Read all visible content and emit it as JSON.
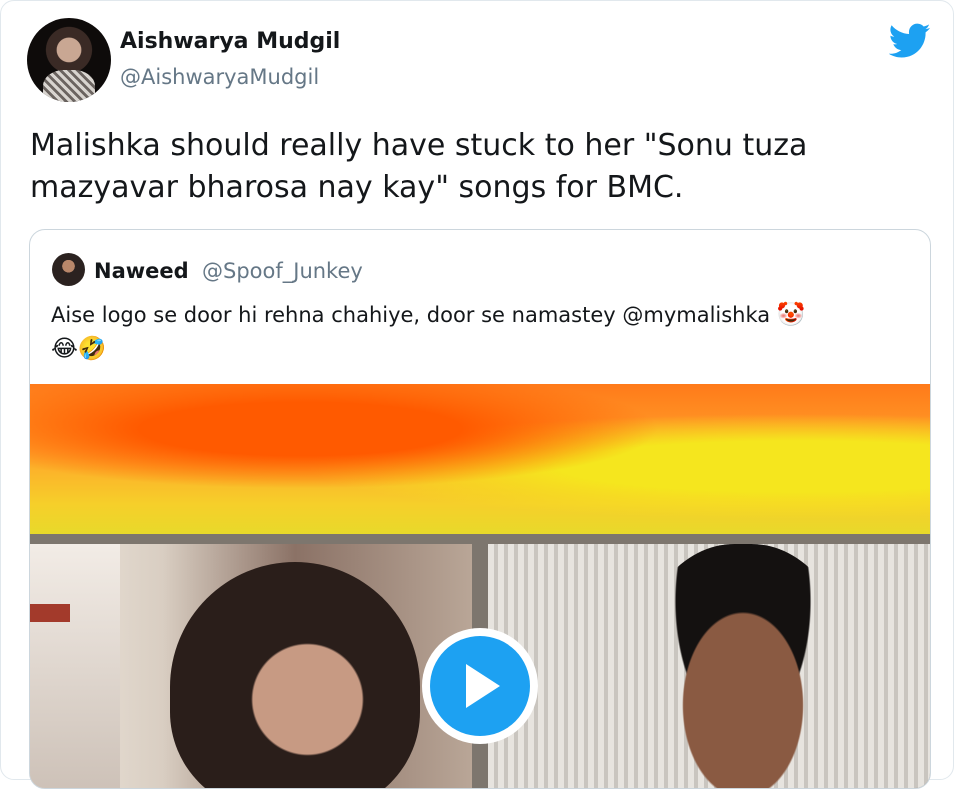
{
  "tweet": {
    "author_name": "Aishwarya Mudgil",
    "author_handle": "@AishwaryaMudgil",
    "text": "Malishka should really have stuck to her \"Sonu tuza mazyavar bharosa nay kay\" songs for BMC."
  },
  "quoted_tweet": {
    "author_name": "Naweed",
    "author_handle": "@Spoof_Junkey",
    "text": "Aise logo se door hi rehna chahiye, door se namastey @mymalishka",
    "emojis": [
      "🤡",
      "😂",
      "🤣"
    ]
  },
  "icons": {
    "brand": "twitter-bird-icon",
    "video": "play-icon"
  },
  "colors": {
    "twitter_blue": "#1da1f2",
    "handle_gray": "#657786",
    "text": "#14171a"
  }
}
